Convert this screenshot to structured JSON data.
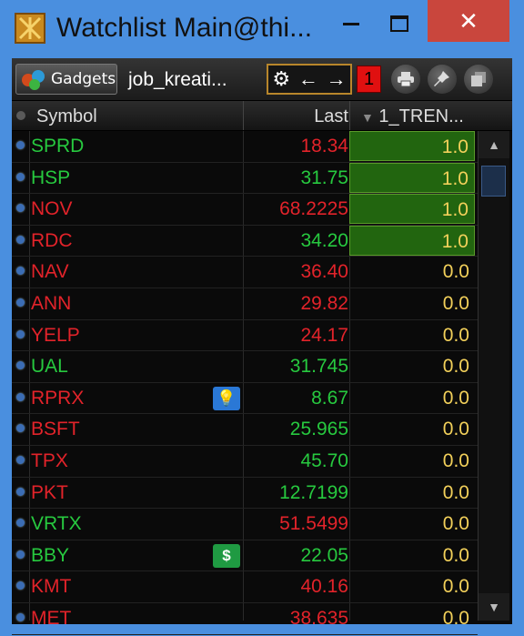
{
  "window": {
    "title": "Watchlist Main@thi...",
    "controls": {
      "minimize": "–",
      "maximize": "☐",
      "close": "✕"
    }
  },
  "toolbar": {
    "gadgets_label": "Gadgets",
    "tab_name": "job_kreati...",
    "link_group": "1",
    "icons": [
      "gear-icon",
      "arrow-left-icon",
      "arrow-right-icon",
      "print-icon",
      "pin-icon",
      "copy-icon"
    ]
  },
  "table": {
    "headers": {
      "symbol": "Symbol",
      "last": "Last",
      "trend": "1_TREN..."
    },
    "rows": [
      {
        "symbol": "SPRD",
        "symbol_color": "green",
        "last": "18.34",
        "last_color": "red",
        "trend": "1.0",
        "highlight": true
      },
      {
        "symbol": "HSP",
        "symbol_color": "green",
        "last": "31.75",
        "last_color": "green",
        "trend": "1.0",
        "highlight": true
      },
      {
        "symbol": "NOV",
        "symbol_color": "red",
        "last": "68.2225",
        "last_color": "red",
        "trend": "1.0",
        "highlight": true
      },
      {
        "symbol": "RDC",
        "symbol_color": "red",
        "last": "34.20",
        "last_color": "green",
        "trend": "1.0",
        "highlight": true
      },
      {
        "symbol": "NAV",
        "symbol_color": "red",
        "last": "36.40",
        "last_color": "red",
        "trend": "0.0",
        "highlight": false
      },
      {
        "symbol": "ANN",
        "symbol_color": "red",
        "last": "29.82",
        "last_color": "red",
        "trend": "0.0",
        "highlight": false
      },
      {
        "symbol": "YELP",
        "symbol_color": "red",
        "last": "24.17",
        "last_color": "red",
        "trend": "0.0",
        "highlight": false
      },
      {
        "symbol": "UAL",
        "symbol_color": "green",
        "last": "31.745",
        "last_color": "green",
        "trend": "0.0",
        "highlight": false
      },
      {
        "symbol": "RPRX",
        "symbol_color": "red",
        "last": "8.67",
        "last_color": "green",
        "trend": "0.0",
        "highlight": false,
        "badge": "bulb"
      },
      {
        "symbol": "BSFT",
        "symbol_color": "red",
        "last": "25.965",
        "last_color": "green",
        "trend": "0.0",
        "highlight": false
      },
      {
        "symbol": "TPX",
        "symbol_color": "red",
        "last": "45.70",
        "last_color": "green",
        "trend": "0.0",
        "highlight": false
      },
      {
        "symbol": "PKT",
        "symbol_color": "red",
        "last": "12.7199",
        "last_color": "green",
        "trend": "0.0",
        "highlight": false
      },
      {
        "symbol": "VRTX",
        "symbol_color": "green",
        "last": "51.5499",
        "last_color": "red",
        "trend": "0.0",
        "highlight": false
      },
      {
        "symbol": "BBY",
        "symbol_color": "green",
        "last": "22.05",
        "last_color": "green",
        "trend": "0.0",
        "highlight": false,
        "badge": "dollar"
      },
      {
        "symbol": "KMT",
        "symbol_color": "red",
        "last": "40.16",
        "last_color": "red",
        "trend": "0.0",
        "highlight": false
      },
      {
        "symbol": "MET",
        "symbol_color": "red",
        "last": "38.635",
        "last_color": "red",
        "trend": "0.0",
        "highlight": false
      }
    ]
  },
  "badges": {
    "bulb": "💡",
    "dollar": "$"
  },
  "colors": {
    "red": "#e2232a",
    "green": "#27c93f",
    "trend_text": "#f2d05a",
    "highlight_bg": "#22650f"
  }
}
